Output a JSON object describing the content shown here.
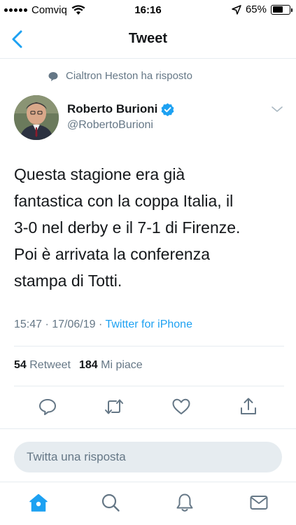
{
  "status_bar": {
    "carrier": "Comviq",
    "time": "16:16",
    "battery": "65%",
    "battery_level": 0.65
  },
  "nav": {
    "title": "Tweet",
    "back_icon": "chevron-left-icon"
  },
  "context": {
    "text": "Cialtron Heston ha risposto"
  },
  "author": {
    "name": "Roberto Burioni",
    "handle": "@RobertoBurioni",
    "verified": true
  },
  "tweet": {
    "text": "Questa stagione era già\nfantastica con la coppa Italia, il\n3-0 nel derby e il 7-1 di Firenze.\nPoi è arrivata la conferenza\nstampa di Totti.",
    "timestamp": "15:47 · 17/06/19 · ",
    "source": "Twitter for iPhone"
  },
  "stats": {
    "retweet_count": "54",
    "retweet_label": "Retweet",
    "like_count": "184",
    "like_label": "Mi piace"
  },
  "reply": {
    "placeholder": "Twitta una risposta"
  },
  "colors": {
    "accent": "#1da1f2",
    "muted": "#657786",
    "text": "#14171a",
    "divider": "#e6ecf0"
  },
  "tabs": [
    "home-icon",
    "search-icon",
    "notifications-icon",
    "messages-icon"
  ]
}
